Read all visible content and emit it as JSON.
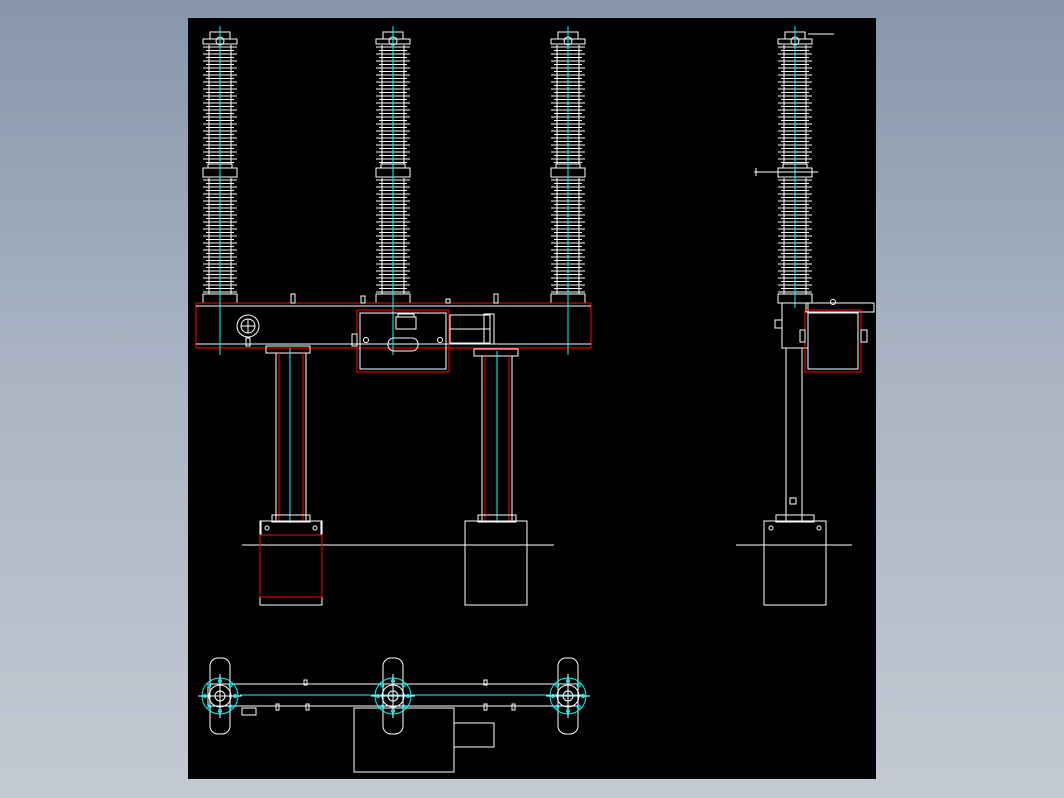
{
  "drawing": {
    "background_color": "#000000",
    "line_colors": {
      "outline": "#ffffff",
      "structure": "#ff0000",
      "centerline": "#00ffff"
    },
    "views": [
      "front-elevation",
      "side-elevation",
      "plan-view"
    ],
    "front_elevation": {
      "insulator_column_count": 3,
      "support_post_count": 2,
      "foundation_block_count": 2
    },
    "side_elevation": {
      "insulator_column_count": 1,
      "support_post_count": 1,
      "foundation_block_count": 1
    },
    "plan_view": {
      "pole_count": 3
    },
    "annotations": []
  }
}
